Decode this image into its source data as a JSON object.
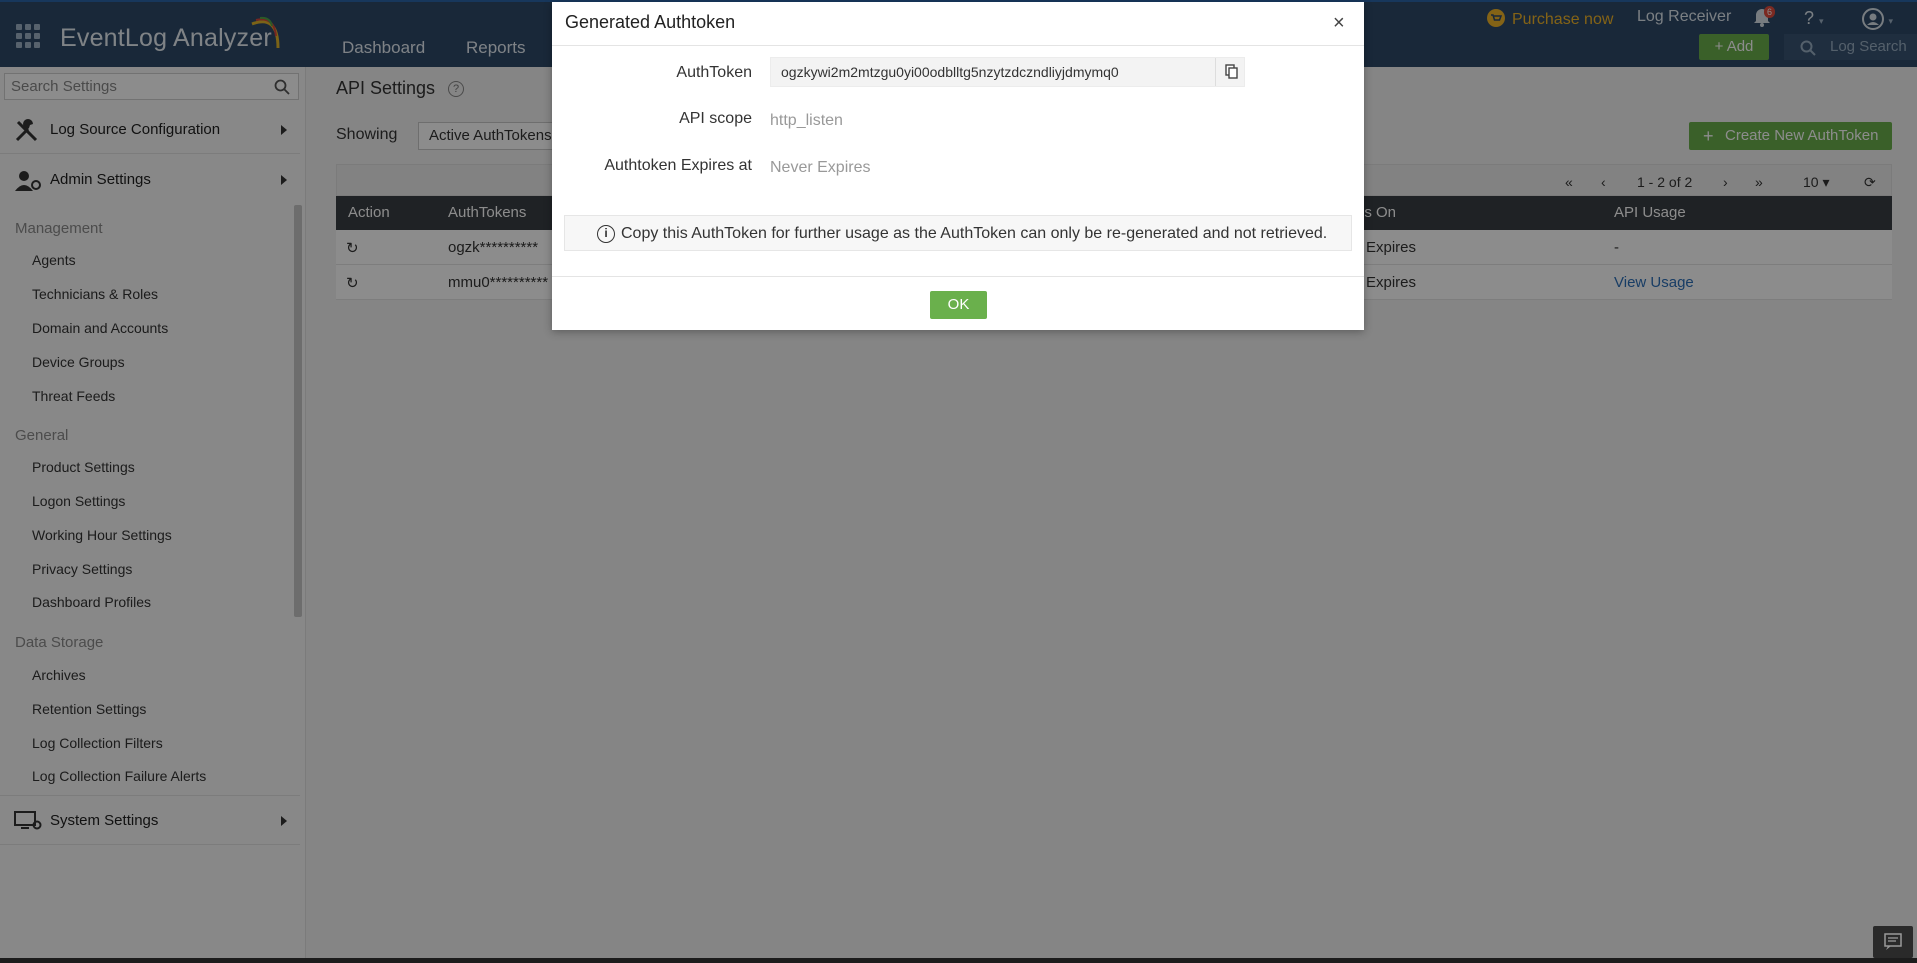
{
  "header": {
    "app_name": "EventLog Analyzer",
    "nav": [
      "Dashboard",
      "Reports"
    ],
    "purchase_label": "Purchase now",
    "log_receiver_label": "Log Receiver",
    "notification_count": "6",
    "help_label": "?",
    "add_label": "Add",
    "log_search_placeholder": "Log Search"
  },
  "sidebar": {
    "search_placeholder": "Search Settings",
    "sections": {
      "log_source": "Log Source Configuration",
      "admin": "Admin Settings",
      "system": "System Settings"
    },
    "groups": {
      "management": {
        "label": "Management",
        "items": [
          "Agents",
          "Technicians & Roles",
          "Domain and Accounts",
          "Device Groups",
          "Threat Feeds"
        ]
      },
      "general": {
        "label": "General",
        "items": [
          "Product Settings",
          "Logon Settings",
          "Working Hour Settings",
          "Privacy Settings",
          "Dashboard Profiles"
        ]
      },
      "data_storage": {
        "label": "Data Storage",
        "items": [
          "Archives",
          "Retention Settings",
          "Log Collection Filters",
          "Log Collection Failure Alerts"
        ]
      }
    }
  },
  "main": {
    "title": "API Settings",
    "showing_label": "Showing",
    "filter_value": "Active AuthTokens",
    "create_button": "Create New AuthToken",
    "pager_text": "1 - 2 of 2",
    "page_size": "10",
    "table": {
      "headers": [
        "Action",
        "AuthTokens",
        "es On",
        "API Usage"
      ],
      "rows": [
        {
          "token": "ogzk**********",
          "expires": "Expires",
          "usage": "-"
        },
        {
          "token": "mmu0**********",
          "expires": "Expires",
          "usage": "View Usage"
        }
      ]
    }
  },
  "modal": {
    "title": "Generated Authtoken",
    "close": "×",
    "authtoken_label": "AuthToken",
    "authtoken_value": "ogzkywi2m2mtzgu0yi00odblltg5nzytzdczndliyjdmymq0",
    "scope_label": "API scope",
    "scope_value": "http_listen",
    "expires_label": "Authtoken Expires at",
    "expires_value": "Never Expires",
    "info_text": "Copy this AuthToken for further usage as the AuthToken can only be re-generated and not retrieved.",
    "ok_label": "OK"
  },
  "colors": {
    "header_bg": "#2f4a68",
    "accent_green": "#6ab04c",
    "table_head": "#3a3f44",
    "link": "#2d6fb8",
    "purchase": "#f0b429"
  }
}
